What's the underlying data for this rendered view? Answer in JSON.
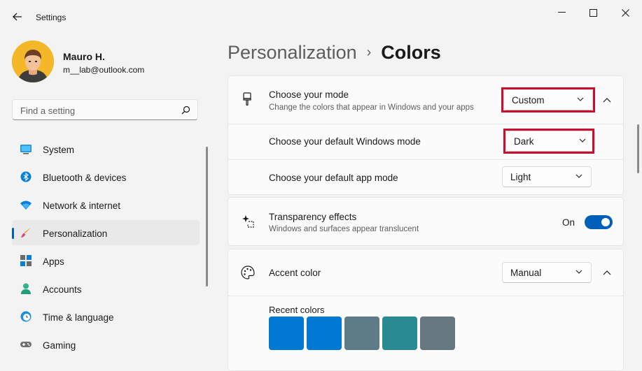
{
  "window": {
    "title": "Settings"
  },
  "user": {
    "name": "Mauro H.",
    "email": "m__lab@outlook.com"
  },
  "search": {
    "placeholder": "Find a setting"
  },
  "sidebar": {
    "items": [
      {
        "label": "System",
        "icon": "monitor-icon"
      },
      {
        "label": "Bluetooth & devices",
        "icon": "bluetooth-icon"
      },
      {
        "label": "Network & internet",
        "icon": "wifi-icon"
      },
      {
        "label": "Personalization",
        "icon": "paintbrush-icon",
        "selected": true
      },
      {
        "label": "Apps",
        "icon": "apps-icon"
      },
      {
        "label": "Accounts",
        "icon": "person-icon"
      },
      {
        "label": "Time & language",
        "icon": "globe-clock-icon"
      },
      {
        "label": "Gaming",
        "icon": "gamepad-icon"
      }
    ]
  },
  "header": {
    "parent": "Personalization",
    "separator": "›",
    "current": "Colors"
  },
  "mode_card": {
    "title": "Choose your mode",
    "description": "Change the colors that appear in Windows and your apps",
    "value": "Custom",
    "windows_mode": {
      "label": "Choose your default Windows mode",
      "value": "Dark"
    },
    "app_mode": {
      "label": "Choose your default app mode",
      "value": "Light"
    }
  },
  "transparency": {
    "title": "Transparency effects",
    "description": "Windows and surfaces appear translucent",
    "state_label": "On"
  },
  "accent": {
    "title": "Accent color",
    "value": "Manual",
    "recent_label": "Recent colors",
    "recent_colors": [
      "#0078d4",
      "#0078d4",
      "#5e7b88",
      "#2a8a94",
      "#67777f"
    ]
  },
  "colors": {
    "accent": "#005fb8",
    "highlight_outline": "#c8102e"
  }
}
